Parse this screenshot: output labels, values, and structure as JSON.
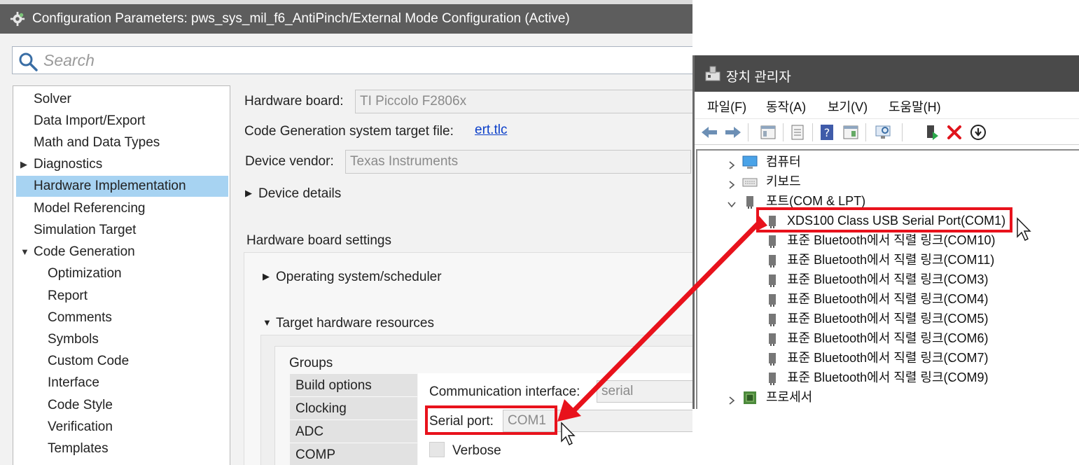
{
  "config_window": {
    "title": "Configuration Parameters: pws_sys_mil_f6_AntiPinch/External Mode Configuration (Active)",
    "search_placeholder": "Search",
    "tree": [
      {
        "label": "Solver"
      },
      {
        "label": "Data Import/Export"
      },
      {
        "label": "Math and Data Types"
      },
      {
        "label": "Diagnostics"
      },
      {
        "label": "Hardware Implementation"
      },
      {
        "label": "Model Referencing"
      },
      {
        "label": "Simulation Target"
      },
      {
        "label": "Code Generation"
      },
      {
        "label": "Optimization"
      },
      {
        "label": "Report"
      },
      {
        "label": "Comments"
      },
      {
        "label": "Symbols"
      },
      {
        "label": "Custom Code"
      },
      {
        "label": "Interface"
      },
      {
        "label": "Code Style"
      },
      {
        "label": "Verification"
      },
      {
        "label": "Templates"
      }
    ],
    "hardware_board_label": "Hardware board:",
    "hardware_board_value": "TI Piccolo F2806x",
    "codegen_target_label": "Code Generation system target file:",
    "codegen_target_link": "ert.tlc",
    "device_vendor_label": "Device vendor:",
    "device_vendor_value": "Texas Instruments",
    "device_details": "Device details",
    "hw_board_settings": "Hardware board settings",
    "os_scheduler": "Operating system/scheduler",
    "target_hw_resources": "Target hardware resources",
    "groups_label": "Groups",
    "groups": [
      "Build options",
      "Clocking",
      "ADC",
      "COMP"
    ],
    "comm_interface_label": "Communication interface:",
    "comm_interface_value": "serial",
    "serial_port_label": "Serial port:",
    "serial_port_value": "COM1",
    "verbose_label": "Verbose"
  },
  "device_manager": {
    "title": "장치 관리자",
    "menu": [
      "파일(F)",
      "동작(A)",
      "보기(V)",
      "도움말(H)"
    ],
    "tree": {
      "computer": "컴퓨터",
      "keyboard": "키보드",
      "ports": "포트(COM & LPT)",
      "port_items": [
        "XDS100 Class USB Serial Port(COM1)",
        "표준 Bluetooth에서 직렬 링크(COM10)",
        "표준 Bluetooth에서 직렬 링크(COM11)",
        "표준 Bluetooth에서 직렬 링크(COM3)",
        "표준 Bluetooth에서 직렬 링크(COM4)",
        "표준 Bluetooth에서 직렬 링크(COM5)",
        "표준 Bluetooth에서 직렬 링크(COM6)",
        "표준 Bluetooth에서 직렬 링크(COM7)",
        "표준 Bluetooth에서 직렬 링크(COM9)"
      ],
      "processor": "프로세서"
    }
  },
  "colors": {
    "highlight_red": "#e8121c",
    "selection_blue": "#a7d3f2",
    "link_blue": "#0b3fc9"
  }
}
